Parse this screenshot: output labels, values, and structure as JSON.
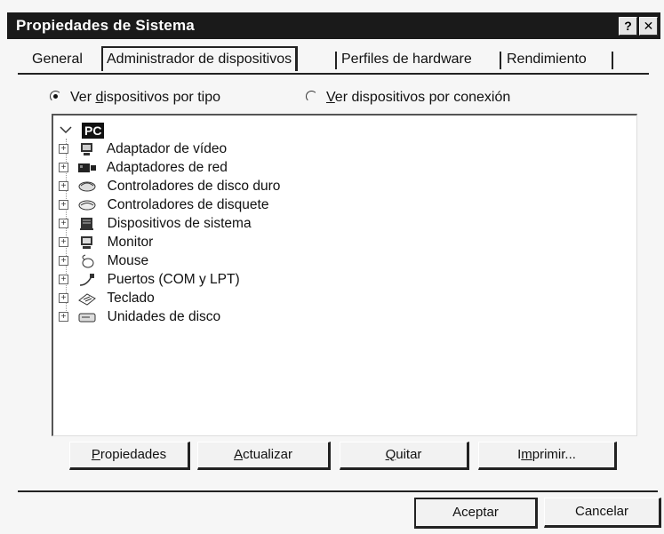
{
  "window": {
    "title": "Propiedades de Sistema",
    "help_label": "?",
    "close_label": "✕"
  },
  "tabs": [
    {
      "label": "General",
      "active": false
    },
    {
      "label": "Administrador de dispositivos",
      "active": true
    },
    {
      "label": "Perfiles de hardware",
      "active": false
    },
    {
      "label": "Rendimiento",
      "active": false
    }
  ],
  "view_options": {
    "by_type": {
      "label_pre": "Ver ",
      "label_u": "d",
      "label_post": "ispositivos por tipo",
      "selected": true
    },
    "by_connection": {
      "label_pre": "",
      "label_u": "V",
      "label_post": "er dispositivos por conexión",
      "selected": false
    }
  },
  "tree": {
    "root": {
      "label": "PC",
      "icon": "computer-icon"
    },
    "items": [
      {
        "label": "Adaptador de vídeo",
        "icon": "monitor-icon"
      },
      {
        "label": "Adaptadores de red",
        "icon": "network-card-icon"
      },
      {
        "label": "Controladores de disco duro",
        "icon": "disk-controller-icon"
      },
      {
        "label": "Controladores de disquete",
        "icon": "floppy-controller-icon"
      },
      {
        "label": "Dispositivos de sistema",
        "icon": "system-device-icon"
      },
      {
        "label": "Monitor",
        "icon": "monitor-icon"
      },
      {
        "label": "Mouse",
        "icon": "mouse-icon"
      },
      {
        "label": "Puertos (COM y LPT)",
        "icon": "port-icon"
      },
      {
        "label": "Teclado",
        "icon": "keyboard-icon"
      },
      {
        "label": "Unidades de disco",
        "icon": "disk-drive-icon"
      }
    ],
    "expander_label": "+"
  },
  "actions": {
    "properties": {
      "u": "P",
      "rest": "ropiedades"
    },
    "refresh": {
      "u": "A",
      "rest": "ctualizar"
    },
    "remove": {
      "u": "Q",
      "rest": "uitar"
    },
    "print": {
      "pre": "I",
      "u": "m",
      "rest": "primir..."
    }
  },
  "footer": {
    "ok_label": "Aceptar",
    "cancel_label": "Cancelar"
  }
}
